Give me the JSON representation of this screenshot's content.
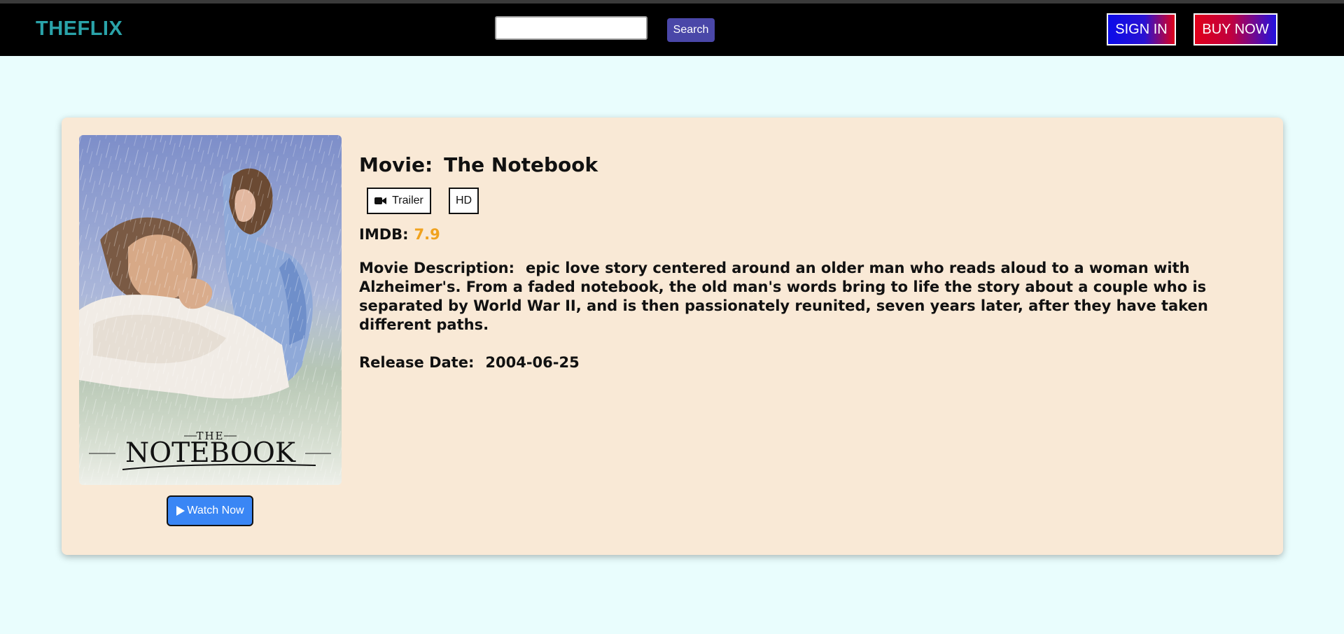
{
  "header": {
    "brand": "THEFLIX",
    "search_placeholder": "",
    "search_label": "Search",
    "sign_in_label": "SIGN IN",
    "buy_now_label": "BUY NOW"
  },
  "movie": {
    "title_label": "Movie:",
    "title": "The Notebook",
    "tags": [
      "Trailer",
      "HD"
    ],
    "imdb_label": "IMDB:",
    "imdb_score": "7.9",
    "description_label": "Movie Description:",
    "description": "epic love story centered around an older man who reads aloud to a woman with Alzheimer's. From a faded notebook, the old man's words bring to life the story about a couple who is separated by World War II, and is then passionately reunited, seven years later, after they have taken different paths.",
    "release_label": "Release Date:",
    "release_date": "2004-06-25",
    "watch_label": "Watch Now",
    "poster": {
      "small_title": "THE",
      "big_title": "NOTEBOOK"
    }
  },
  "icons": {
    "trailer": "video-camera-icon",
    "watch": "play-icon"
  },
  "colors": {
    "navbar": "#000000",
    "brand": "#2aa3a9",
    "page_bg": "#e9fdfd",
    "card_bg": "#f9e9d6",
    "search_button": "#4a47a8",
    "watch_button": "#3a86f5",
    "imdb_score": "#f0a21e"
  }
}
